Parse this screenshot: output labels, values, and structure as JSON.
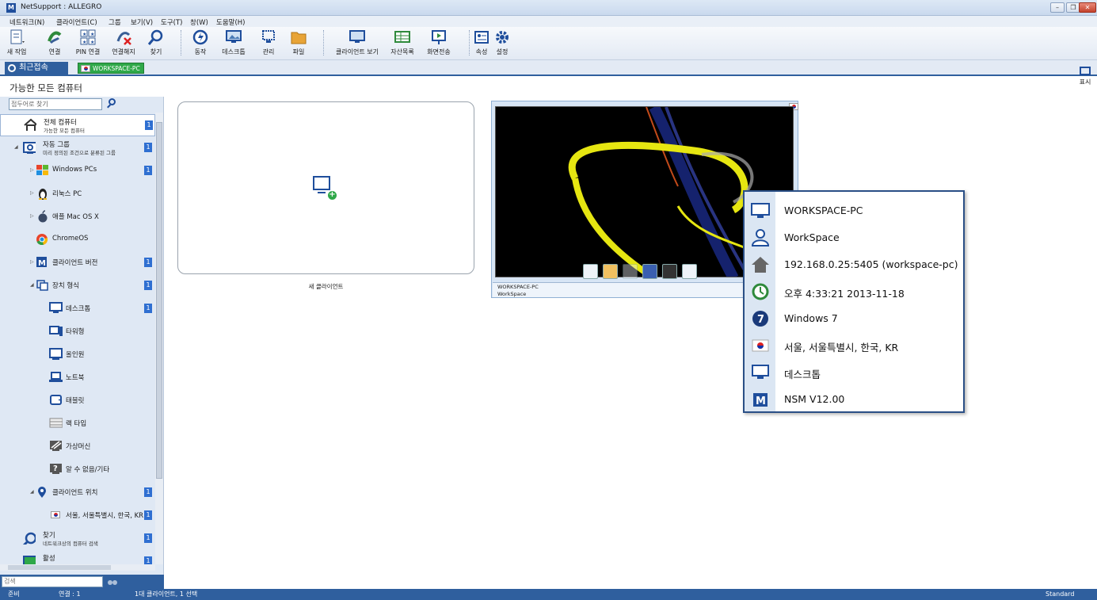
{
  "window": {
    "title": "NetSupport : ALLEGRO",
    "app_icon_letter": "M",
    "min": "–",
    "restore": "❐",
    "close": "✕"
  },
  "menu": [
    "네트워크(N)",
    "클라이언트(C)",
    "그룹",
    "보기(V)",
    "도구(T)",
    "창(W)",
    "도움말(H)"
  ],
  "toolbar": {
    "new_task": "새 작업",
    "connect": "연결",
    "pin_connect": "PIN 연결",
    "disconnect": "연결해지",
    "find": "찾기",
    "action": "동작",
    "desktop": "데스크톱",
    "manage": "관리",
    "file": "파일",
    "client_view": "클라이언트 보기",
    "inventory": "자산목록",
    "screen_send": "화면전송",
    "properties": "속성",
    "settings": "설정"
  },
  "tabs": {
    "recent": "최근접속",
    "workspace": "WORKSPACE-PC"
  },
  "display_button": "표시",
  "heading": "가능한 모든 컴퓨터",
  "left_panel": {
    "search_placeholder": "접두어로 찾기",
    "bottom_search_placeholder": "검색",
    "tree": {
      "all": {
        "title": "전체 컴퓨터",
        "subtitle": "가능한 모든 컴퓨터",
        "count": "1"
      },
      "auto_group": {
        "title": "자동 그룹",
        "subtitle": "미리 정의된 조건으로 분류된 그룹",
        "count": "1"
      },
      "windows": {
        "label": "Windows PCs",
        "count": "1"
      },
      "linux": {
        "label": "리눅스 PC"
      },
      "mac": {
        "label": "애플 Mac OS X"
      },
      "chrome": {
        "label": "ChromeOS"
      },
      "client_version": {
        "label": "클라이언트 버전",
        "count": "1"
      },
      "device_type": {
        "label": "장치 형식",
        "count": "1"
      },
      "desktop": {
        "label": "데스크톱",
        "count": "1"
      },
      "tower": {
        "label": "타워형"
      },
      "allinone": {
        "label": "올인원"
      },
      "notebook": {
        "label": "노트북"
      },
      "tablet": {
        "label": "태블릿"
      },
      "rack": {
        "label": "랙 타입"
      },
      "vm": {
        "label": "가상머신"
      },
      "unknown": {
        "label": "알 수 없음/기타"
      },
      "location": {
        "label": "클라이언트 위치",
        "count": "1"
      },
      "seoul": {
        "label": "서울, 서울특별시, 한국, KR",
        "count": "1"
      },
      "find": {
        "title": "찾기",
        "subtitle": "네트워크상의 컴퓨터 검색",
        "count": "1"
      },
      "active": {
        "title": "활성",
        "count": "1"
      }
    }
  },
  "main": {
    "new_client_label": "새 클라이언트",
    "workspace_card": {
      "name": "WORKSPACE-PC",
      "user": "WorkSpace"
    }
  },
  "info_popup": {
    "computer": "WORKSPACE-PC",
    "user": "WorkSpace",
    "address": "192.168.0.25:5405 (workspace-pc)",
    "time": "오후 4:33:21 2013-11-18",
    "os": "Windows 7",
    "location": "서울, 서울특별시, 한국, KR",
    "device": "데스크톱",
    "version": "NSM V12.00"
  },
  "status": {
    "ready": "준비",
    "connections": "연결 : 1",
    "clients": "1대 클라이언트, 1 선택",
    "mode": "Standard"
  },
  "colors": {
    "accent": "#2f5f9e",
    "badge": "#2f6fd1",
    "green": "#2fa849"
  }
}
